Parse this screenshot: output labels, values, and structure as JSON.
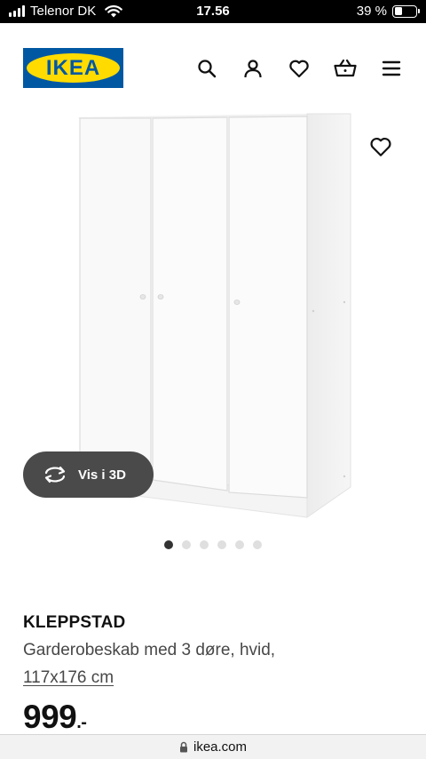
{
  "status_bar": {
    "carrier": "Telenor DK",
    "time": "17.56",
    "battery_percent": "39 %",
    "battery_level": 0.39
  },
  "header": {
    "logo_text": "IKEA",
    "icons": [
      "search-icon",
      "account-icon",
      "wishlist-icon",
      "basket-icon",
      "menu-icon"
    ]
  },
  "gallery": {
    "view_3d_label": "Vis i 3D",
    "dot_count": 6,
    "active_dot": 1
  },
  "product": {
    "name": "KLEPPSTAD",
    "description": "Garderobeskab med 3 døre, hvid,",
    "size": "117x176 cm",
    "price": "999",
    "price_suffix": ".-"
  },
  "url_bar": {
    "domain": "ikea.com"
  },
  "colors": {
    "ikea_blue": "#0058A3",
    "ikea_yellow": "#FFDB00",
    "view3d_bg": "#4a4a4a"
  }
}
